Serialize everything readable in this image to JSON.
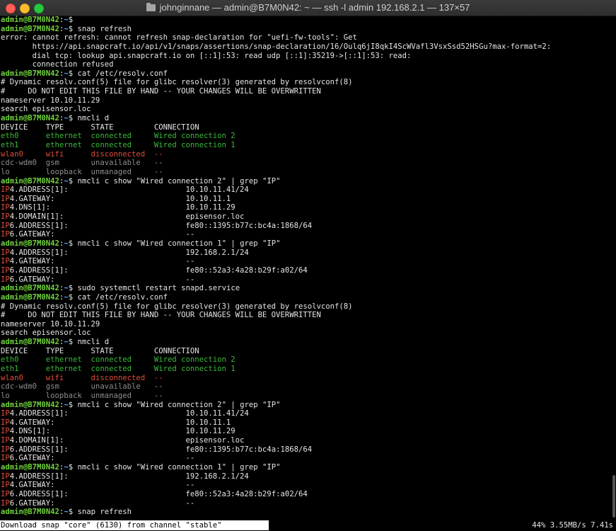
{
  "window": {
    "title": "johnginnane — admin@B7M0N42: ~ — ssh -l admin 192.168.2.1 — 137×57"
  },
  "colors": {
    "prompt_user": "#6fd13b",
    "prompt_path": "#5fa8ff",
    "connected": "#3bb83b",
    "disconnected": "#e04c38",
    "unmanaged": "#8d8d8d"
  },
  "prompt": {
    "user": "admin@B7M0N42",
    "sep": ":",
    "path": "~",
    "sign": "$ "
  },
  "lines": [
    {
      "type": "prompt",
      "cmd": ""
    },
    {
      "type": "prompt",
      "cmd": "snap refresh"
    },
    {
      "type": "text",
      "text": "error: cannot refresh: cannot refresh snap-declaration for \"uefi-fw-tools\": Get"
    },
    {
      "type": "text",
      "text": "       https://api.snapcraft.io/api/v1/snaps/assertions/snap-declaration/16/Oulq6jI8qkI4ScWVafl3VsxSsd52HSGu?max-format=2:"
    },
    {
      "type": "text",
      "text": "       dial tcp: lookup api.snapcraft.io on [::1]:53: read udp [::1]:35219->[::1]:53: read:"
    },
    {
      "type": "text",
      "text": "       connection refused"
    },
    {
      "type": "prompt",
      "cmd": "cat /etc/resolv.conf"
    },
    {
      "type": "text",
      "text": "# Dynamic resolv.conf(5) file for glibc resolver(3) generated by resolvconf(8)"
    },
    {
      "type": "text",
      "text": "#     DO NOT EDIT THIS FILE BY HAND -- YOUR CHANGES WILL BE OVERWRITTEN"
    },
    {
      "type": "text",
      "text": "nameserver 10.10.11.29"
    },
    {
      "type": "text",
      "text": "search episensor.loc"
    },
    {
      "type": "prompt",
      "cmd": "nmcli d"
    },
    {
      "type": "text",
      "text": "DEVICE    TYPE      STATE         CONNECTION"
    },
    {
      "type": "text",
      "class": "c-green",
      "text": "eth0      ethernet  connected     Wired connection 2"
    },
    {
      "type": "text",
      "class": "c-green",
      "text": "eth1      ethernet  connected     Wired connection 1"
    },
    {
      "type": "text",
      "class": "c-red",
      "text": "wlan0     wifi      disconnected  --"
    },
    {
      "type": "text",
      "class": "c-gray",
      "text": "cdc-wdm0  gsm       unavailable   --"
    },
    {
      "type": "text",
      "class": "c-gray",
      "text": "lo        loopback  unmanaged     --"
    },
    {
      "type": "prompt",
      "cmd": "nmcli c show \"Wired connection 2\" | grep \"IP\""
    },
    {
      "type": "ip",
      "hl": "IP",
      "rest": "4.ADDRESS[1]:                          10.10.11.41/24"
    },
    {
      "type": "ip",
      "hl": "IP",
      "rest": "4.GATEWAY:                             10.10.11.1"
    },
    {
      "type": "ip",
      "hl": "IP",
      "rest": "4.DNS[1]:                              10.10.11.29"
    },
    {
      "type": "ip",
      "hl": "IP",
      "rest": "4.DOMAIN[1]:                           episensor.loc"
    },
    {
      "type": "ip",
      "hl": "IP",
      "rest": "6.ADDRESS[1]:                          fe80::1395:b77c:bc4a:1868/64"
    },
    {
      "type": "ip",
      "hl": "IP",
      "rest": "6.GATEWAY:                             --"
    },
    {
      "type": "prompt",
      "cmd": "nmcli c show \"Wired connection 1\" | grep \"IP\""
    },
    {
      "type": "ip",
      "hl": "IP",
      "rest": "4.ADDRESS[1]:                          192.168.2.1/24"
    },
    {
      "type": "ip",
      "hl": "IP",
      "rest": "4.GATEWAY:                             --"
    },
    {
      "type": "ip",
      "hl": "IP",
      "rest": "6.ADDRESS[1]:                          fe80::52a3:4a28:b29f:a02/64"
    },
    {
      "type": "ip",
      "hl": "IP",
      "rest": "6.GATEWAY:                             --"
    },
    {
      "type": "prompt",
      "cmd": "sudo systemctl restart snapd.service"
    },
    {
      "type": "prompt",
      "cmd": "cat /etc/resolv.conf"
    },
    {
      "type": "text",
      "text": "# Dynamic resolv.conf(5) file for glibc resolver(3) generated by resolvconf(8)"
    },
    {
      "type": "text",
      "text": "#     DO NOT EDIT THIS FILE BY HAND -- YOUR CHANGES WILL BE OVERWRITTEN"
    },
    {
      "type": "text",
      "text": "nameserver 10.10.11.29"
    },
    {
      "type": "text",
      "text": "search episensor.loc"
    },
    {
      "type": "prompt",
      "cmd": "nmcli d"
    },
    {
      "type": "text",
      "text": "DEVICE    TYPE      STATE         CONNECTION"
    },
    {
      "type": "text",
      "class": "c-green",
      "text": "eth0      ethernet  connected     Wired connection 2"
    },
    {
      "type": "text",
      "class": "c-green",
      "text": "eth1      ethernet  connected     Wired connection 1"
    },
    {
      "type": "text",
      "class": "c-red",
      "text": "wlan0     wifi      disconnected  --"
    },
    {
      "type": "text",
      "class": "c-gray",
      "text": "cdc-wdm0  gsm       unavailable   --"
    },
    {
      "type": "text",
      "class": "c-gray",
      "text": "lo        loopback  unmanaged     --"
    },
    {
      "type": "prompt",
      "cmd": "nmcli c show \"Wired connection 2\" | grep \"IP\""
    },
    {
      "type": "ip",
      "hl": "IP",
      "rest": "4.ADDRESS[1]:                          10.10.11.41/24"
    },
    {
      "type": "ip",
      "hl": "IP",
      "rest": "4.GATEWAY:                             10.10.11.1"
    },
    {
      "type": "ip",
      "hl": "IP",
      "rest": "4.DNS[1]:                              10.10.11.29"
    },
    {
      "type": "ip",
      "hl": "IP",
      "rest": "4.DOMAIN[1]:                           episensor.loc"
    },
    {
      "type": "ip",
      "hl": "IP",
      "rest": "6.ADDRESS[1]:                          fe80::1395:b77c:bc4a:1868/64"
    },
    {
      "type": "ip",
      "hl": "IP",
      "rest": "6.GATEWAY:                             --"
    },
    {
      "type": "prompt",
      "cmd": "nmcli c show \"Wired connection 1\" | grep \"IP\""
    },
    {
      "type": "ip",
      "hl": "IP",
      "rest": "4.ADDRESS[1]:                          192.168.2.1/24"
    },
    {
      "type": "ip",
      "hl": "IP",
      "rest": "4.GATEWAY:                             --"
    },
    {
      "type": "ip",
      "hl": "IP",
      "rest": "6.ADDRESS[1]:                          fe80::52a3:4a28:b29f:a02/64"
    },
    {
      "type": "ip",
      "hl": "IP",
      "rest": "6.GATEWAY:                             --"
    },
    {
      "type": "prompt",
      "cmd": "snap refresh"
    }
  ],
  "status": {
    "left": "Download snap \"core\" (6130) from channel \"stable\"",
    "right": "44% 3.55MB/s 7.41s",
    "progress_percent": 44
  }
}
